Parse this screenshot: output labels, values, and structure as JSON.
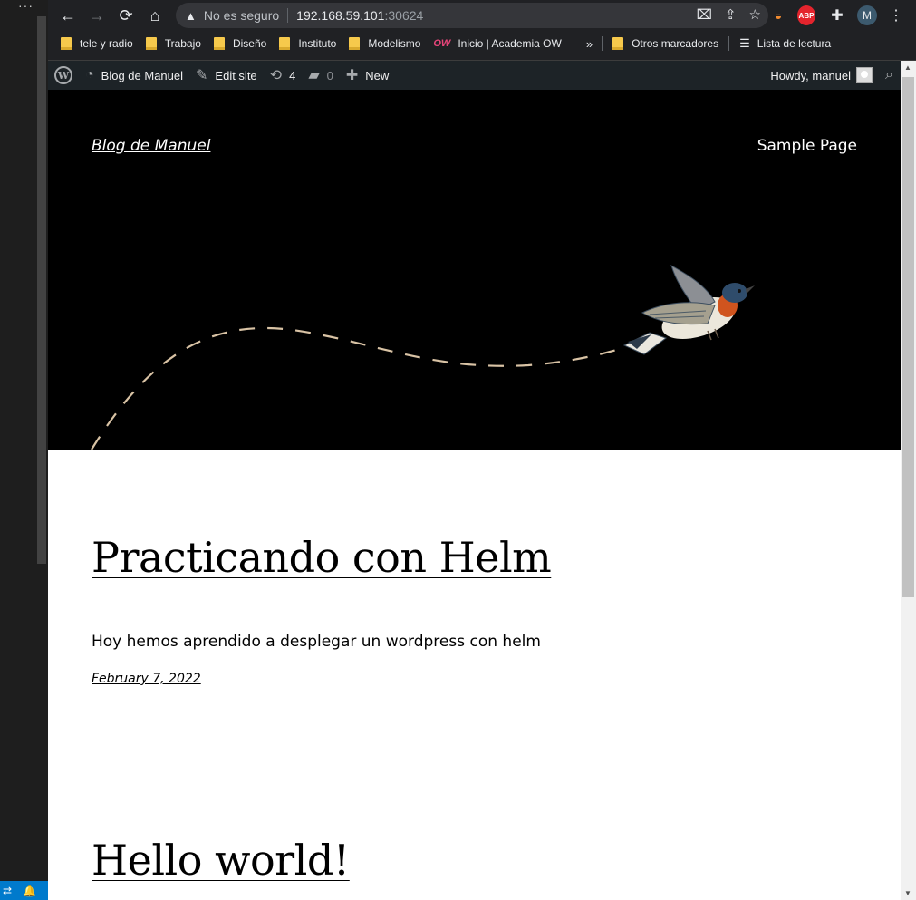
{
  "editor": {
    "menu_dots": "···"
  },
  "browser": {
    "omnibox": {
      "security_label": "No es seguro",
      "host": "192.168.59.101",
      "port": ":30624"
    },
    "extensions": {
      "adblock_label": "ABP",
      "profile_initial": "M"
    },
    "bookmarks": [
      {
        "label": "tele y radio",
        "icon": "folder-icon"
      },
      {
        "label": "Trabajo",
        "icon": "folder-icon"
      },
      {
        "label": "Diseño",
        "icon": "folder-icon"
      },
      {
        "label": "Instituto",
        "icon": "folder-icon"
      },
      {
        "label": "Modelismo",
        "icon": "folder-icon"
      },
      {
        "label": "Inicio | Academia OW",
        "icon": "academia-ow-icon"
      }
    ],
    "other_bookmarks": "Otros marcadores",
    "reading_list": "Lista de lectura"
  },
  "adminbar": {
    "site_name": "Blog de Manuel",
    "edit_site": "Edit site",
    "updates_count": "4",
    "comments_count": "0",
    "new_label": "New",
    "howdy": "Howdy, manuel"
  },
  "site": {
    "title": "Blog de Manuel",
    "nav": [
      "Sample Page"
    ]
  },
  "posts": [
    {
      "title": "Practicando con Helm",
      "excerpt": "Hoy hemos aprendido a desplegar un wordpress con helm",
      "date": "February 7, 2022"
    },
    {
      "title": "Hello world!"
    }
  ],
  "colors": {
    "adminbar_bg": "#1d2327",
    "header_bg": "#000000",
    "dash_color": "#d9c3a5",
    "abp_red": "#e4242d",
    "status_blue": "#007acc"
  }
}
